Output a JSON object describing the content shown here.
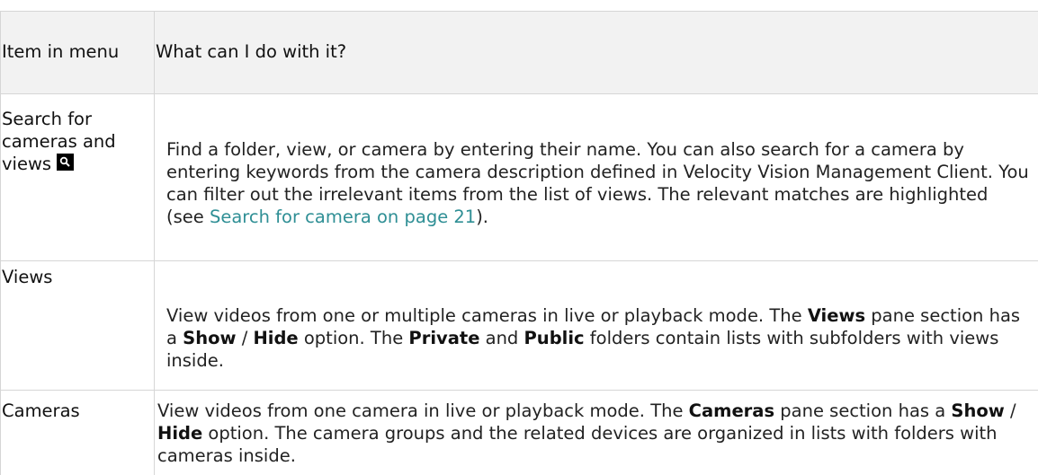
{
  "table": {
    "headers": {
      "item": "Item in menu",
      "what": "What can I do with it?"
    },
    "rows": [
      {
        "item_line1": "Search for",
        "item_line2": "cameras and",
        "item_line3": "views",
        "icon": "search-icon",
        "description": {
          "p1": "Find a folder, view, or camera by entering their name. You can also search for a camera by entering keywords from the camera description defined in Velocity Vision Management Client. You can filter out the irrelevant items from the list of views. The relevant matches are highlighted (see ",
          "link": "Search for camera on page 21",
          "p2": ")."
        }
      },
      {
        "item": "Views",
        "description": {
          "t1": "View videos from one or multiple cameras in live or playback mode. The ",
          "b1": "Views",
          "t2": " pane section has a ",
          "b2": "Show",
          "t3": " / ",
          "b3": "Hide",
          "t4": " option. The ",
          "b4": "Private",
          "t5": " and ",
          "b5": "Public",
          "t6": " folders contain lists with subfolders with views inside."
        }
      },
      {
        "item": "Cameras",
        "description": {
          "t1": "View videos from one camera in live or playback mode. The ",
          "b1": "Cameras",
          "t2": " pane section has a ",
          "b2": "Show",
          "t3": " / ",
          "b3": "Hide",
          "t4": " option. The camera groups and the related devices are organized in lists with folders with cameras inside."
        }
      }
    ]
  }
}
